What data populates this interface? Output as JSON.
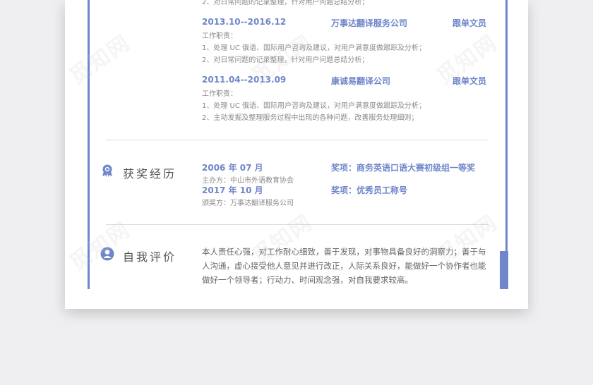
{
  "top_partial": {
    "line": "2、对日常问题的记录整理，针对用户问题总结分析；"
  },
  "work": [
    {
      "date": "2013.10--2016.12",
      "company": "万事达翻译服务公司",
      "role": "跟单文员",
      "label": "工作职责：",
      "items": [
        "1、处理 UC 俄语、国际用户咨询及建议，对用户满意度做跟踪及分析；",
        "2、对日常问题的记录整理，针对用户问题总结分析；"
      ]
    },
    {
      "date": "2011.04--2013.09",
      "company": "康诚易翻译公司",
      "role": "跟单文员",
      "label": "工作职责：",
      "items": [
        "1、处理 UC 俄语、国际用户咨询及建议，对用户满意度做跟踪及分析；",
        "2、主动发掘及整理服务过程中出现的各种问题，改善服务处理细则；"
      ]
    }
  ],
  "awards_section": {
    "title": "获奖经历",
    "icon": "award-icon",
    "entries": [
      {
        "date": "2006 年 07 月",
        "org": "主办方：中山市外语教育协会",
        "award": "奖项：商务英语口语大赛初级组一等奖"
      },
      {
        "date": "2017 年 10 月",
        "org": "颁奖方：万事达翻译服务公司",
        "award": "奖项：优秀员工称号"
      }
    ]
  },
  "self_section": {
    "title": "自我评价",
    "icon": "user-icon",
    "text": "本人责任心强，对工作耐心细致，善于发现，对事物具备良好的洞察力；善于与人沟通，虚心接受他人意见并进行改正，人际关系良好，能做好一个协作者也能做好一个领导者；行动力、时间观念强，对自我要求较高。"
  },
  "watermark": "觅知网",
  "colors": {
    "accent": "#6f86c9",
    "text": "#666666",
    "background": "#efeff1"
  }
}
